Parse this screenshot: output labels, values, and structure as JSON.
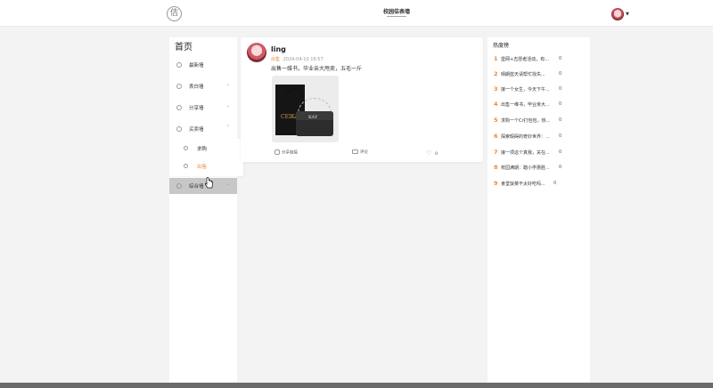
{
  "header": {
    "logo_text": "佶",
    "site_title": "校园佶表墙"
  },
  "sidebar": {
    "home_title": "首页",
    "items": [
      {
        "label": "最新墙"
      },
      {
        "label": "表白墙"
      },
      {
        "label": "分享墙"
      },
      {
        "label": "买卖墙"
      },
      {
        "label": "综合墙"
      }
    ],
    "submenu": [
      {
        "label": "求购"
      },
      {
        "label": "出售"
      }
    ]
  },
  "post": {
    "user": "ling",
    "category": "出售",
    "date": "2024-04-10 16:57",
    "text": "出售一维书，毕业亲大甩卖，五毛一斤",
    "image_box_label": "CEIKAY",
    "image_bag_label": "KAY",
    "share_label": "分享链接",
    "comment_label": "评论",
    "like_count": "0"
  },
  "hot": {
    "title": "热度榜",
    "items": [
      {
        "rank": "1",
        "title": "堡网+志愿者活动，有...",
        "count": "0"
      },
      {
        "rank": "2",
        "title": "晴朗蓝天请帮忙找失...",
        "count": "0"
      },
      {
        "rank": "3",
        "title": "接一个女生，今天下午...",
        "count": "0"
      },
      {
        "rank": "4",
        "title": "出售一维书，毕业亲大...",
        "count": "0"
      },
      {
        "rank": "5",
        "title": "求购一个Cr打包包，热...",
        "count": "0"
      },
      {
        "rank": "6",
        "title": "探索瑕碍的奇妙世界：...",
        "count": "0"
      },
      {
        "rank": "7",
        "title": "接一项这个真我，关在...",
        "count": "0"
      },
      {
        "rank": "8",
        "title": "校园满期：踏小学惠胜...",
        "count": "0"
      },
      {
        "rank": "9",
        "title": "食堂饭菜不太好吃吗...",
        "count": "0"
      }
    ]
  }
}
